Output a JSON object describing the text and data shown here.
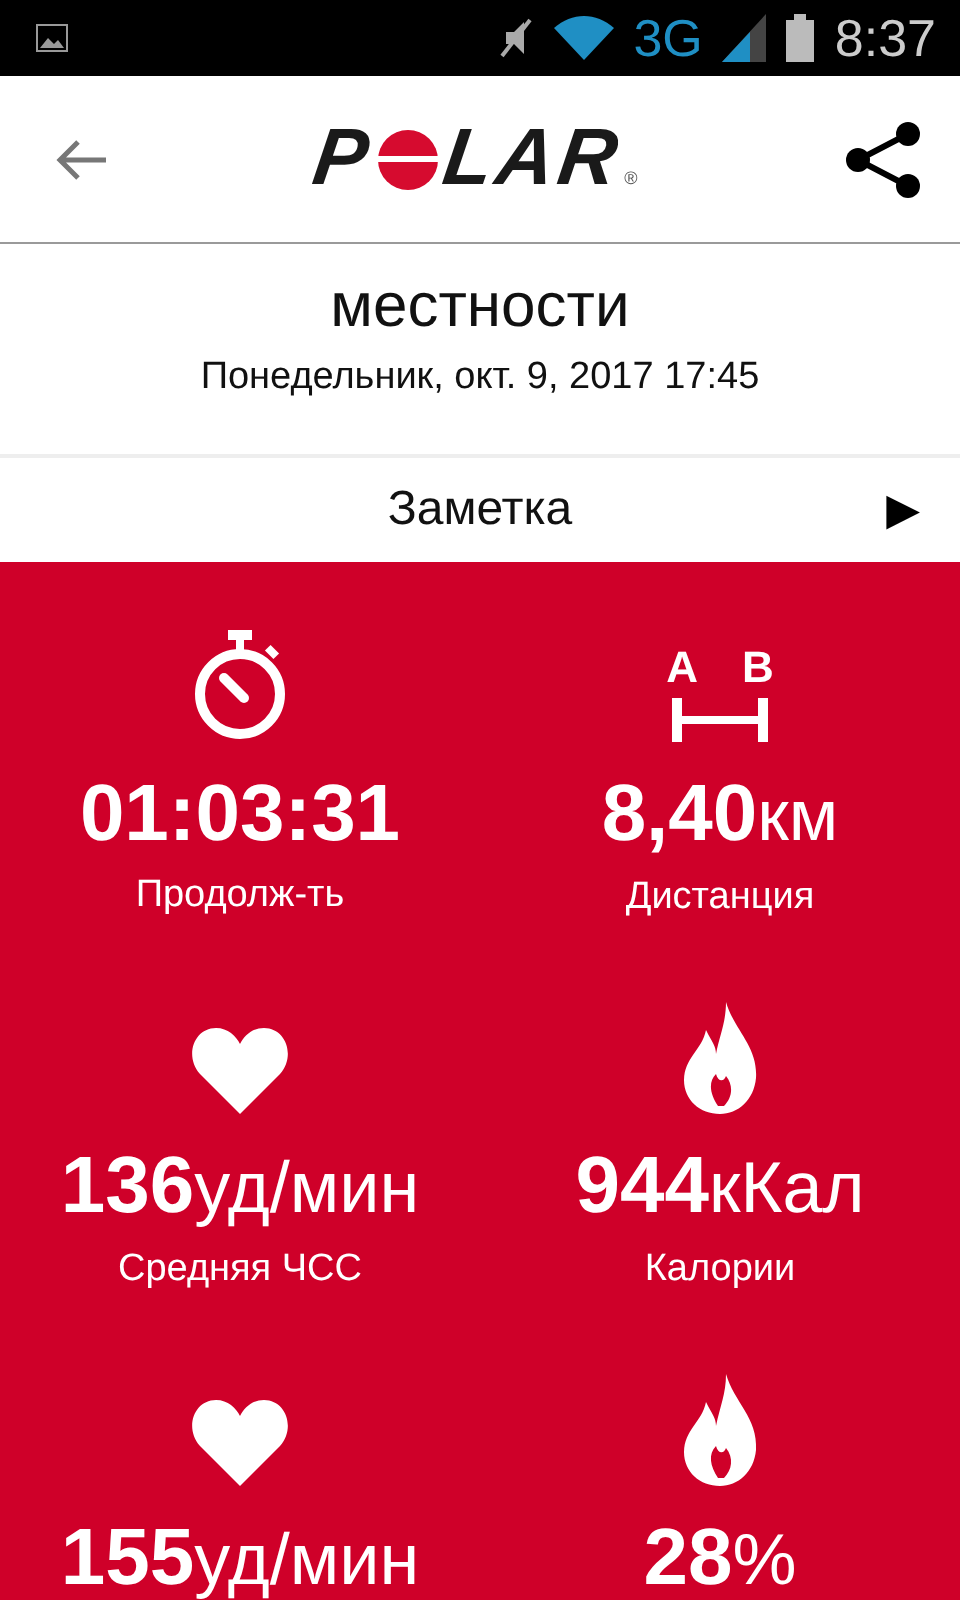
{
  "status_bar": {
    "network": "3G",
    "time": "8:37"
  },
  "header": {
    "logo": {
      "before": "P",
      "after": "LAR",
      "mark": "®"
    }
  },
  "activity": {
    "title_lines": [
      "местности"
    ],
    "date": "Понедельник, окт. 9, 2017 17:45"
  },
  "note_row": {
    "label": "Заметка",
    "arrow": "▶"
  },
  "distance_icon_letters": [
    "A",
    "B"
  ],
  "stats": [
    {
      "kind": "stopwatch",
      "value": "01:03:31",
      "label": "Продолж-ть"
    },
    {
      "kind": "distance",
      "value": "8,40",
      "unit": "км",
      "label": "Дистанция"
    },
    {
      "kind": "heart",
      "value": "136",
      "unit": "уд/мин",
      "label": "Средняя ЧСС"
    },
    {
      "kind": "flame",
      "value": "944",
      "unit": "кКал",
      "label": "Калории"
    },
    {
      "kind": "heart",
      "value": "155",
      "unit": "уд/мин"
    },
    {
      "kind": "flame",
      "value": "28",
      "unit": "%"
    }
  ]
}
